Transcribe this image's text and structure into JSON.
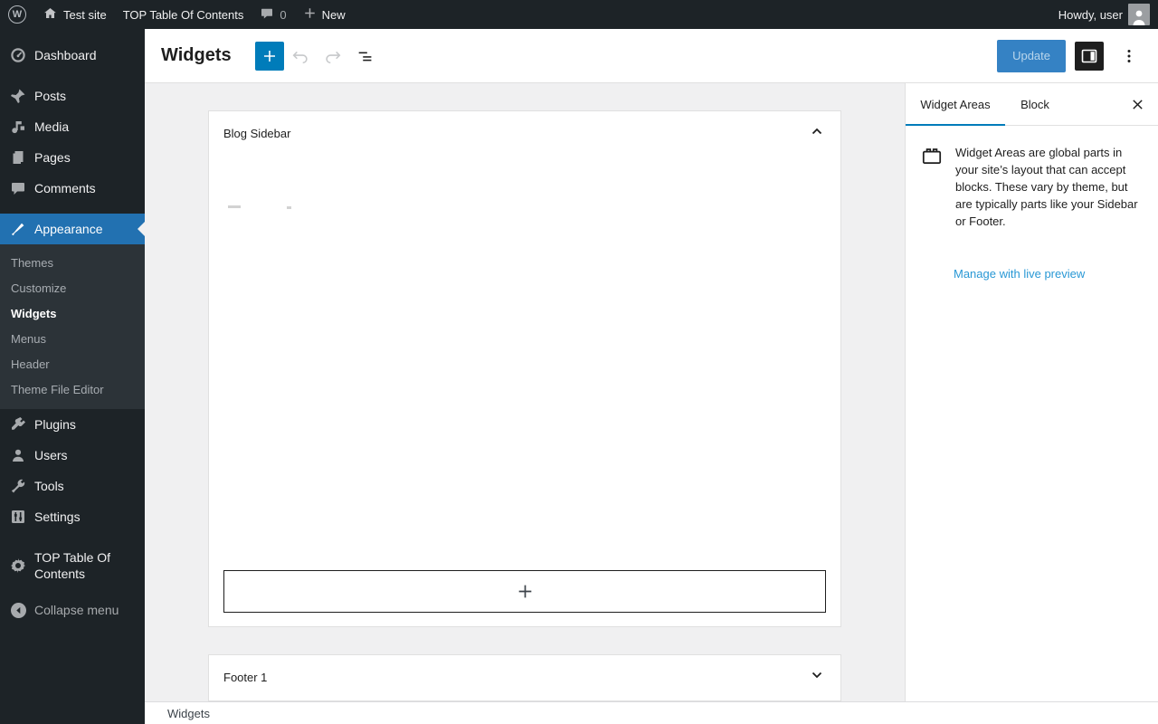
{
  "admin_bar": {
    "site_name": "Test site",
    "toc_label": "TOP Table Of Contents",
    "comment_count": "0",
    "new_label": "New",
    "howdy": "Howdy, user",
    "wp_logo_letter": "W"
  },
  "sidebar": {
    "items": [
      {
        "label": "Dashboard",
        "icon": "dashboard-icon"
      },
      {
        "label": "Posts",
        "icon": "pin-icon"
      },
      {
        "label": "Media",
        "icon": "media-icon"
      },
      {
        "label": "Pages",
        "icon": "pages-icon"
      },
      {
        "label": "Comments",
        "icon": "comment-icon"
      },
      {
        "label": "Appearance",
        "icon": "brush-icon",
        "active": true
      },
      {
        "label": "Plugins",
        "icon": "plugin-icon"
      },
      {
        "label": "Users",
        "icon": "user-icon"
      },
      {
        "label": "Tools",
        "icon": "wrench-icon"
      },
      {
        "label": "Settings",
        "icon": "sliders-icon"
      },
      {
        "label": "TOP Table Of Contents",
        "icon": "gear-icon"
      },
      {
        "label": "Collapse menu",
        "icon": "collapse-arrow-icon"
      }
    ],
    "submenu": [
      {
        "label": "Themes"
      },
      {
        "label": "Customize"
      },
      {
        "label": "Widgets",
        "current": true
      },
      {
        "label": "Menus"
      },
      {
        "label": "Header"
      },
      {
        "label": "Theme File Editor"
      }
    ]
  },
  "editor": {
    "title": "Widgets",
    "update_label": "Update"
  },
  "panels": [
    {
      "title": "Blog Sidebar",
      "expanded": true
    },
    {
      "title": "Footer 1",
      "expanded": false
    }
  ],
  "inspector": {
    "tabs": [
      {
        "label": "Widget Areas"
      },
      {
        "label": "Block"
      }
    ],
    "description": "Widget Areas are global parts in your site’s layout that can accept blocks. These vary by theme, but are typically parts like your Sidebar or Footer.",
    "link_label": "Manage with live preview"
  },
  "footer": {
    "breadcrumb": "Widgets"
  },
  "colors": {
    "admin_dark": "#1d2327",
    "submenu_bg": "#2c3338",
    "menu_active_blue": "#2271b1",
    "editor_accent": "#007cba",
    "link_blue": "#2998d5",
    "canvas_gray": "#f0f0f1"
  }
}
